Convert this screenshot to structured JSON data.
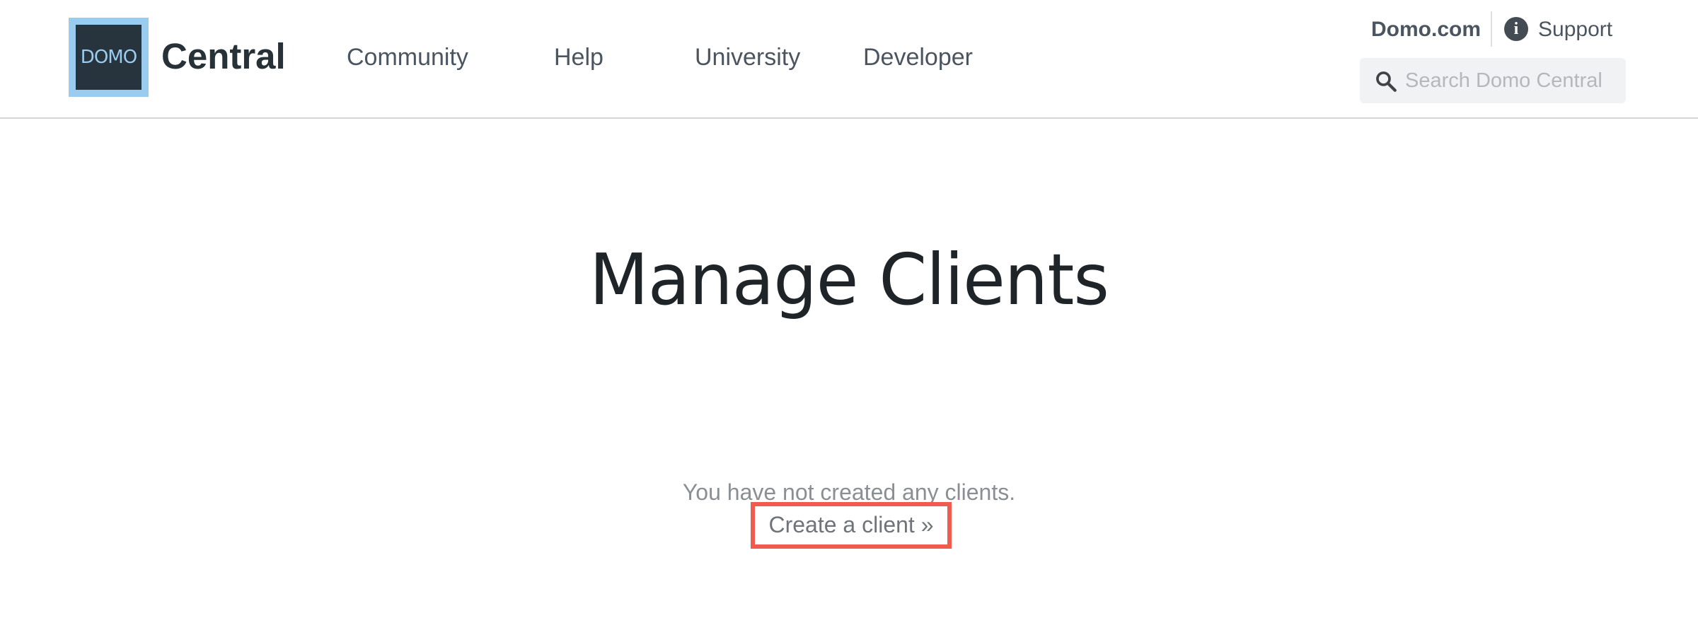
{
  "header": {
    "logo_text": "DOMO",
    "brand": "Central",
    "nav": [
      {
        "label": "Community"
      },
      {
        "label": "Help"
      },
      {
        "label": "University"
      },
      {
        "label": "Developer"
      }
    ],
    "top_links": {
      "domo": "Domo.com",
      "support": "Support"
    },
    "search": {
      "placeholder": "Search Domo Central",
      "value": ""
    }
  },
  "main": {
    "title": "Manage Clients",
    "empty_message": "You have not created any clients.",
    "create_link": "Create a client »"
  },
  "icons": {
    "support": "info-icon",
    "search": "search-icon"
  },
  "colors": {
    "logo_bg": "#99ccee",
    "logo_inner": "#27333d",
    "highlight": "#ef5b4f",
    "search_bg": "#f1f2f3"
  }
}
